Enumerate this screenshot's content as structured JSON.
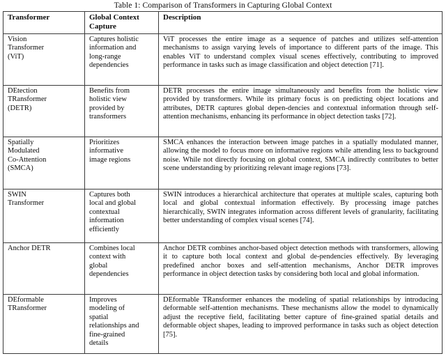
{
  "caption": "Table 1: Comparison of Transformers in Capturing Global Context",
  "table": {
    "headers": {
      "col1": "Transformer",
      "col2": "Global Context Capture",
      "col3": "Description"
    },
    "rows": [
      {
        "name": "Vision\nTransformer\n(ViT)",
        "capture": "Captures holistic\ninformation and\nlong-range\ndependencies",
        "description": "ViT processes the entire image as a sequence of patches and utilizes self-attention mechanisms to assign varying levels of importance to different parts of the image. This enables ViT to understand complex visual scenes effectively, contributing to improved performance in tasks such as image classification and object detection [71]."
      },
      {
        "name": "DEtection\nTRansformer\n(DETR)",
        "capture": "Benefits from\nholistic view\nprovided by\ntransformers",
        "description": "DETR processes the entire image simultaneously and benefits from the holistic view provided by transformers. While its primary focus is on predicting object locations and attributes, DETR captures global depen-dencies and contextual information through self-attention mechanisms, enhancing its performance in object detection tasks [72]."
      },
      {
        "name": "Spatially\nModulated\nCo-Attention\n(SMCA)",
        "capture": "Prioritizes\ninformative\nimage regions",
        "description": "SMCA enhances the interaction between image patches in a spatially modulated manner, allowing the model to focus more on informative regions while attending less to background noise. While not directly focusing on global context, SMCA indirectly contributes to better scene understanding by prioritizing relevant image regions [73]."
      },
      {
        "name": "SWIN\nTransformer",
        "capture": "Captures both\nlocal and global\ncontextual\ninformation\nefficiently",
        "description": "SWIN introduces a hierarchical architecture that operates at multiple scales, capturing both local and global contextual information effectively. By processing image patches hierarchically, SWIN integrates information across different levels of granularity, facilitating better understanding of complex visual scenes [74]."
      },
      {
        "name": "Anchor DETR",
        "capture": "Combines local\ncontext with\nglobal\ndependencies",
        "description": "Anchor DETR combines anchor-based object detection methods with transformers, allowing it to capture both local context and global de-pendencies effectively. By leveraging predefined anchor boxes and self-attention mechanisms, Anchor DETR improves performance in object detection tasks by considering both local and global information."
      },
      {
        "name": "DEformable\nTRansformer",
        "capture": "Improves\nmodeling of\nspatial\nrelationships and\nfine-grained\ndetails",
        "description": "DEformable TRansformer enhances the modeling of spatial relationships by introducing deformable self-attention mechanisms. These mechanisms allow the model to dynamically adjust the receptive field, facilitating better capture of fine-grained spatial details and deformable object shapes, leading to improved performance in tasks such as object detection [75]."
      }
    ]
  }
}
